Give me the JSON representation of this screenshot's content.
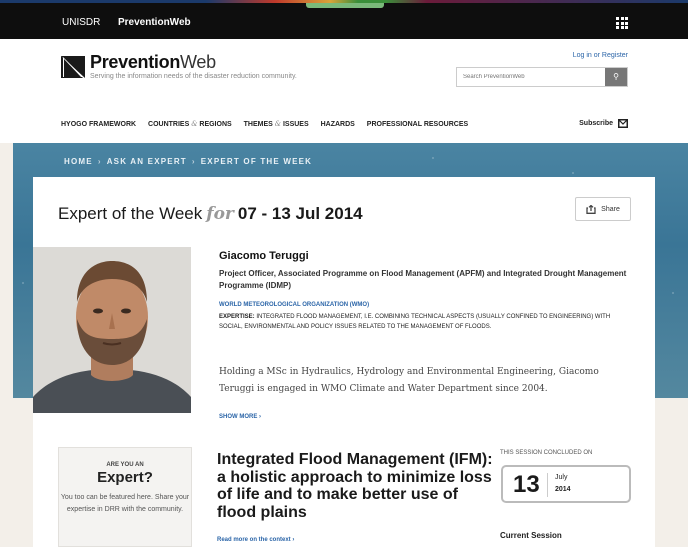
{
  "topbar": {
    "link1": "UNISDR",
    "link2": "PreventionWeb"
  },
  "header": {
    "logo_bold": "Prevention",
    "logo_light": "Web",
    "tagline": "Serving the information needs of the disaster reduction community.",
    "login": "Log in or Register",
    "search_placeholder": "Search PreventionWeb",
    "search_icon": "search-icon"
  },
  "nav": {
    "hyogo": "HYOGO FRAMEWORK",
    "countries_a": "COUNTRIES",
    "countries_amp": "&",
    "countries_b": "REGIONS",
    "themes_a": "THEMES",
    "themes_amp": "&",
    "themes_b": "ISSUES",
    "hazards": "HAZARDS",
    "professional": "PROFESSIONAL RESOURCES",
    "subscribe": "Subscribe"
  },
  "breadcrumb": {
    "home": "HOME",
    "ask": "ASK AN EXPERT",
    "current": "EXPERT OF THE WEEK",
    "separator": "›"
  },
  "card": {
    "title_a": "Expert of the Week",
    "title_for": "for",
    "title_dates": "07 - 13 Jul 2014",
    "share": "Share"
  },
  "expert": {
    "name": "Giacomo Teruggi",
    "role": "Project Officer, Associated Programme on Flood Management (APFM) and Integrated Drought Management Programme (IDMP)",
    "org": "WORLD METEOROLOGICAL ORGANIZATION (WMO)",
    "expertise_label": "EXPERTISE:",
    "expertise": "INTEGRATED FLOOD MANAGEMENT, I.E. COMBINING TECHNICAL ASPECTS (USUALLY CONFINED TO ENGINEERING) WITH SOCIAL, ENVIRONMENTAL AND POLICY ISSUES RELATED TO THE MANAGEMENT OF FLOODS.",
    "bio": "Holding a MSc in Hydraulics, Hydrology and Environmental Engineering, Giacomo Teruggi is engaged in WMO Climate and Water Department since 2004.",
    "show_more": "SHOW MORE ›"
  },
  "expert_box": {
    "line1": "ARE YOU AN",
    "line2": "Expert?",
    "line3": "You too can be featured here. Share your expertise in DRR with the community."
  },
  "topic": {
    "title": "Integrated Flood Management (IFM): a holistic approach to minimize loss of life and to make better use of flood plains",
    "link": "Read more on the context ›"
  },
  "session": {
    "label": "THIS SESSION CONCLUDED ON",
    "day": "13",
    "month": "July",
    "year": "2014",
    "current": "Current Session"
  }
}
